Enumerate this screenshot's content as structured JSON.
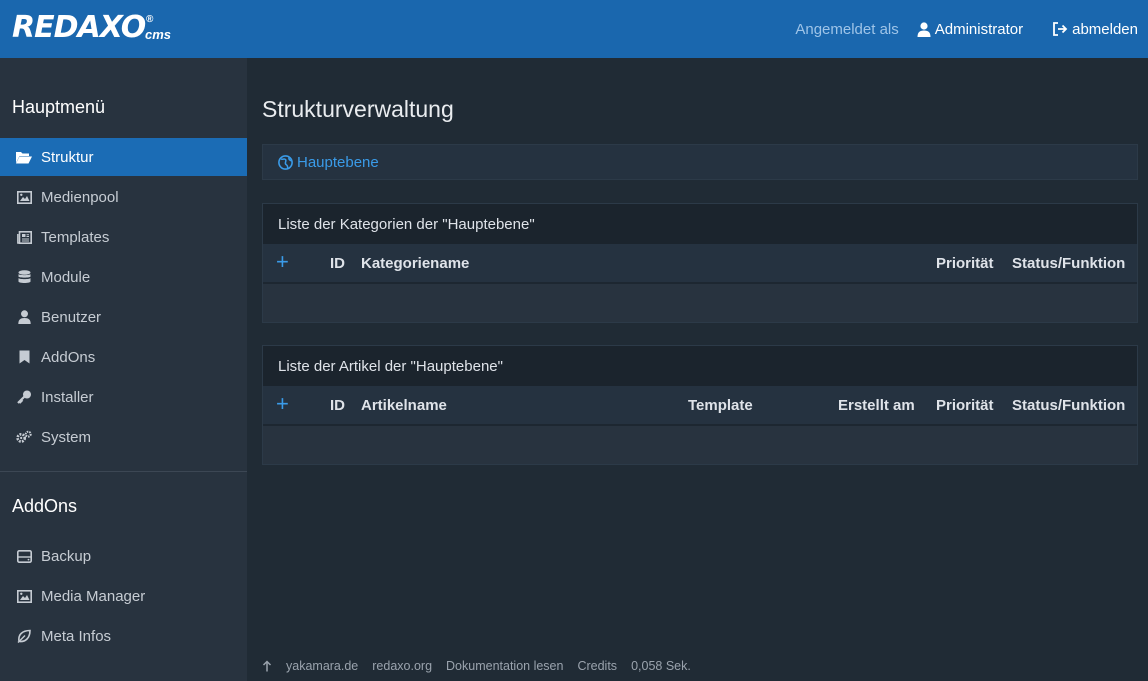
{
  "header": {
    "logo_text": "REDAXO",
    "logo_reg": "®",
    "logo_cms": "cms",
    "logged_in_label": "Angemeldet als",
    "user_name": "Administrator",
    "logout_label": "abmelden"
  },
  "sidebar": {
    "main_heading": "Hauptmenü",
    "items": [
      {
        "label": "Struktur",
        "icon": "folder-open-icon",
        "active": true
      },
      {
        "label": "Medienpool",
        "icon": "image-icon"
      },
      {
        "label": "Templates",
        "icon": "newspaper-icon"
      },
      {
        "label": "Module",
        "icon": "database-icon"
      },
      {
        "label": "Benutzer",
        "icon": "user-icon"
      },
      {
        "label": "AddOns",
        "icon": "bookmark-icon"
      },
      {
        "label": "Installer",
        "icon": "key-icon"
      },
      {
        "label": "System",
        "icon": "cogs-icon"
      }
    ],
    "addons_heading": "AddOns",
    "addon_items": [
      {
        "label": "Backup",
        "icon": "hdd-icon"
      },
      {
        "label": "Media Manager",
        "icon": "image-icon"
      },
      {
        "label": "Meta Infos",
        "icon": "leaf-icon"
      }
    ]
  },
  "main": {
    "title": "Strukturverwaltung",
    "breadcrumb": "Hauptebene",
    "categories_panel": {
      "title": "Liste der Kategorien der \"Hauptebene\"",
      "add": "+",
      "columns": {
        "id": "ID",
        "name": "Kategoriename",
        "priority": "Priorität",
        "status": "Status/Funktion"
      }
    },
    "articles_panel": {
      "title": "Liste der Artikel der \"Hauptebene\"",
      "add": "+",
      "columns": {
        "id": "ID",
        "name": "Artikelname",
        "template": "Template",
        "created": "Erstellt am",
        "priority": "Priorität",
        "status": "Status/Funktion"
      }
    }
  },
  "footer": {
    "links": [
      "yakamara.de",
      "redaxo.org",
      "Dokumentation lesen",
      "Credits"
    ],
    "time": "0,058 Sek."
  },
  "colors": {
    "topbar": "#1a67ae",
    "sidebar": "#28333f",
    "background": "#202b35",
    "accent": "#3a9be8",
    "active_item": "#1b6cb5"
  }
}
